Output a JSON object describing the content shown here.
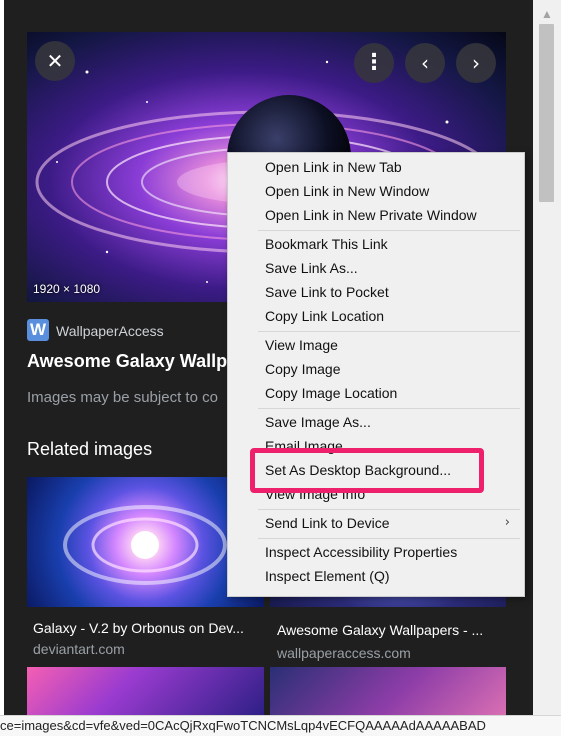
{
  "viewer": {
    "dimensions": "1920 × 1080",
    "source_name": "WallpaperAccess",
    "source_logo_letter": "W",
    "title": "Awesome Galaxy Wallpa",
    "notice": "Images may be subject to co",
    "related_heading": "Related images",
    "buttons": {
      "close_icon": "✕",
      "more_icon": "⋮",
      "prev_icon": "‹",
      "next_icon": "›"
    }
  },
  "related": [
    {
      "title": "Galaxy - V.2 by Orbonus on Dev...",
      "domain": "deviantart.com"
    },
    {
      "title": "Awesome Galaxy Wallpapers - ...",
      "domain": "wallpaperaccess.com"
    }
  ],
  "context_menu": {
    "items": [
      {
        "label": "Open Link in New Tab"
      },
      {
        "label": "Open Link in New Window"
      },
      {
        "label": "Open Link in New Private Window"
      },
      {
        "label": "Bookmark This Link"
      },
      {
        "label": "Save Link As..."
      },
      {
        "label": "Save Link to Pocket"
      },
      {
        "label": "Copy Link Location"
      },
      {
        "label": "View Image"
      },
      {
        "label": "Copy Image"
      },
      {
        "label": "Copy Image Location"
      },
      {
        "label": "Save Image As..."
      },
      {
        "label": "Email Image..."
      },
      {
        "label": "Set As Desktop Background..."
      },
      {
        "label": "View Image Info"
      },
      {
        "label": "Send Link to Device",
        "submenu_arrow": "›"
      },
      {
        "label": "Inspect Accessibility Properties"
      },
      {
        "label": "Inspect Element (Q)"
      }
    ],
    "highlight_color": "#ee1f6b"
  },
  "status_bar": {
    "url": "ce=images&cd=vfe&ved=0CAcQjRxqFwoTCNCMsLqp4vECFQAAAAAdAAAAABAD"
  },
  "scrollbar": {
    "up_icon": "▲"
  }
}
